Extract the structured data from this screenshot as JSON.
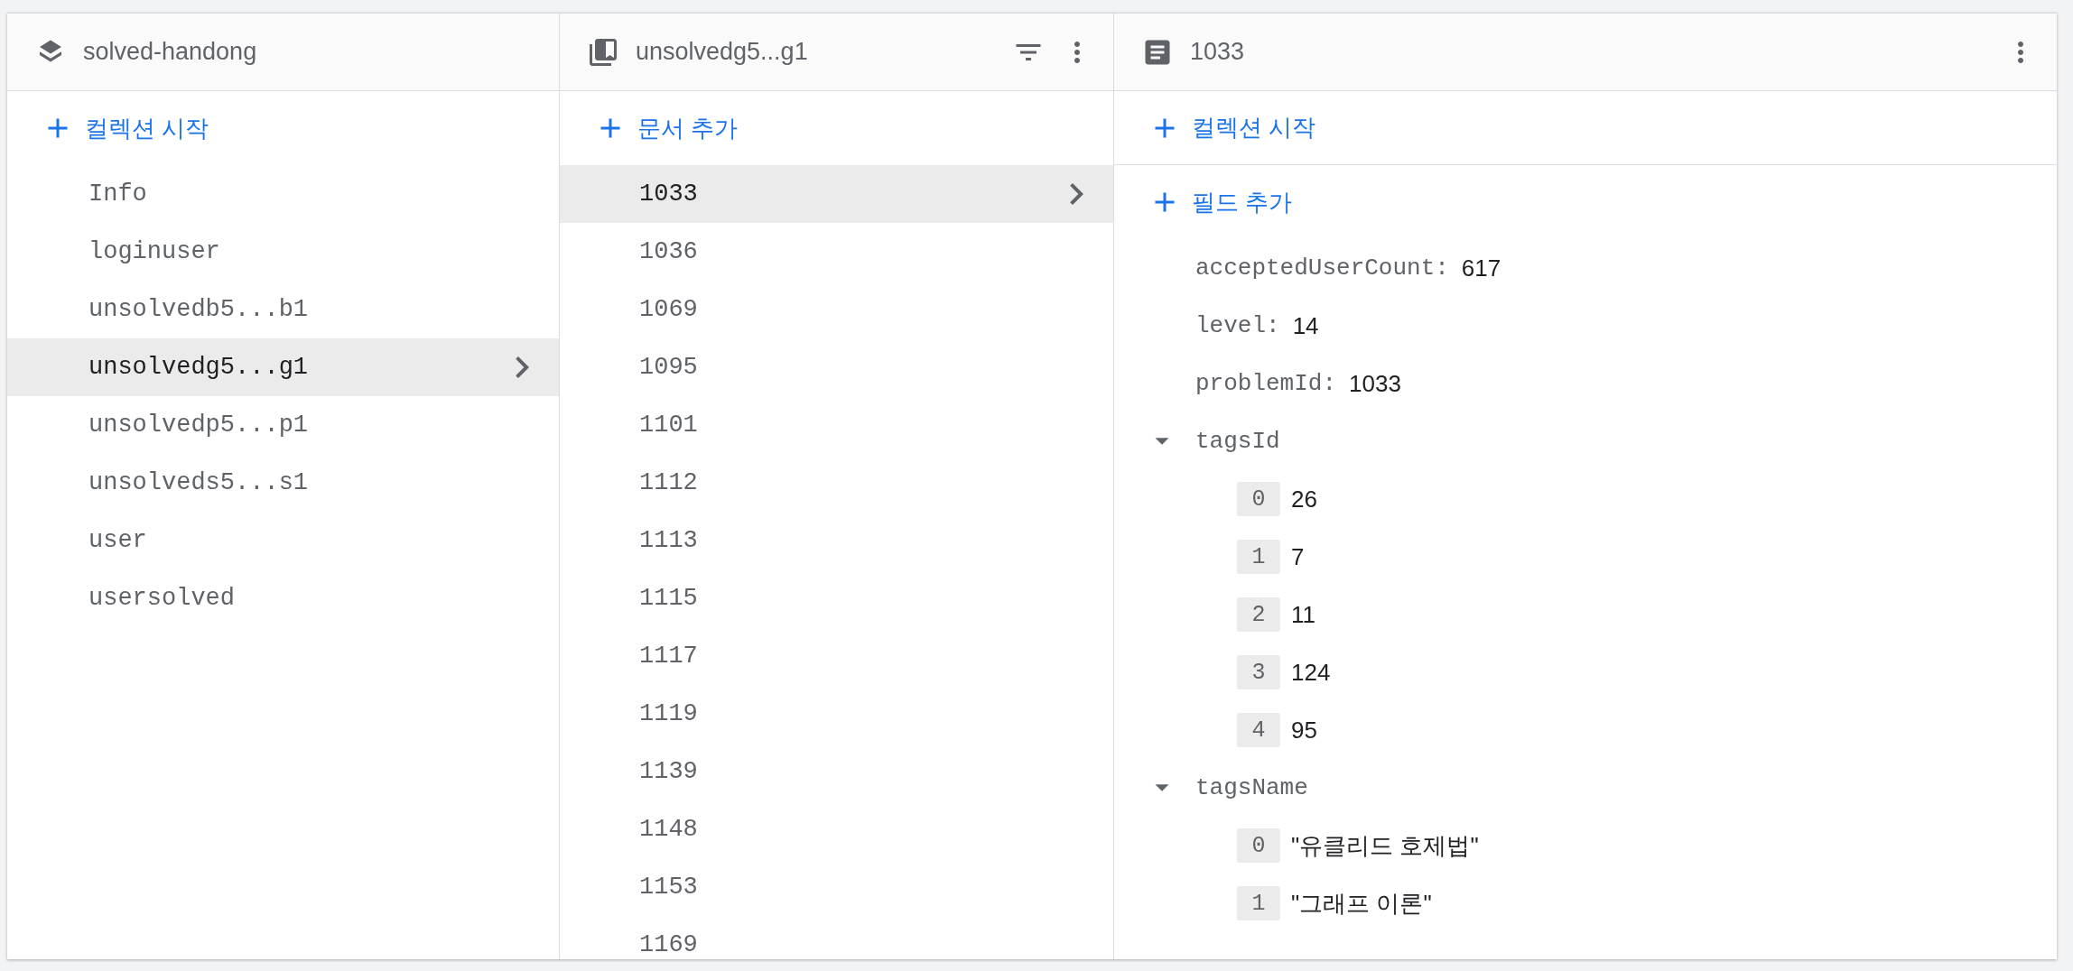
{
  "database": {
    "title": "solved-handong"
  },
  "collections": {
    "add_label": "컬렉션 시작",
    "items": [
      {
        "label": "Info",
        "selected": false
      },
      {
        "label": "loginuser",
        "selected": false
      },
      {
        "label": "unsolvedb5...b1",
        "selected": false
      },
      {
        "label": "unsolvedg5...g1",
        "selected": true
      },
      {
        "label": "unsolvedp5...p1",
        "selected": false
      },
      {
        "label": "unsolveds5...s1",
        "selected": false
      },
      {
        "label": "user",
        "selected": false
      },
      {
        "label": "usersolved",
        "selected": false
      }
    ]
  },
  "documents": {
    "title": "unsolvedg5...g1",
    "add_label": "문서 추가",
    "items": [
      {
        "label": "1033",
        "selected": true
      },
      {
        "label": "1036",
        "selected": false
      },
      {
        "label": "1069",
        "selected": false
      },
      {
        "label": "1095",
        "selected": false
      },
      {
        "label": "1101",
        "selected": false
      },
      {
        "label": "1112",
        "selected": false
      },
      {
        "label": "1113",
        "selected": false
      },
      {
        "label": "1115",
        "selected": false
      },
      {
        "label": "1117",
        "selected": false
      },
      {
        "label": "1119",
        "selected": false
      },
      {
        "label": "1139",
        "selected": false
      },
      {
        "label": "1148",
        "selected": false
      },
      {
        "label": "1153",
        "selected": false
      },
      {
        "label": "1169",
        "selected": false
      }
    ]
  },
  "document": {
    "title": "1033",
    "add_collection_label": "컬렉션 시작",
    "add_field_label": "필드 추가",
    "fields": [
      {
        "kind": "value",
        "key": "acceptedUserCount:",
        "value": "617"
      },
      {
        "kind": "value",
        "key": "level:",
        "value": "14"
      },
      {
        "kind": "value",
        "key": "problemId:",
        "value": "1033"
      },
      {
        "kind": "array",
        "key": "tagsId",
        "expanded": true,
        "items": [
          {
            "index": "0",
            "value": "26"
          },
          {
            "index": "1",
            "value": "7"
          },
          {
            "index": "2",
            "value": "11"
          },
          {
            "index": "3",
            "value": "124"
          },
          {
            "index": "4",
            "value": "95"
          }
        ]
      },
      {
        "kind": "array",
        "key": "tagsName",
        "expanded": true,
        "items": [
          {
            "index": "0",
            "value": "\"유클리드 호제법\""
          },
          {
            "index": "1",
            "value": "\"그래프 이론\""
          }
        ]
      }
    ]
  }
}
